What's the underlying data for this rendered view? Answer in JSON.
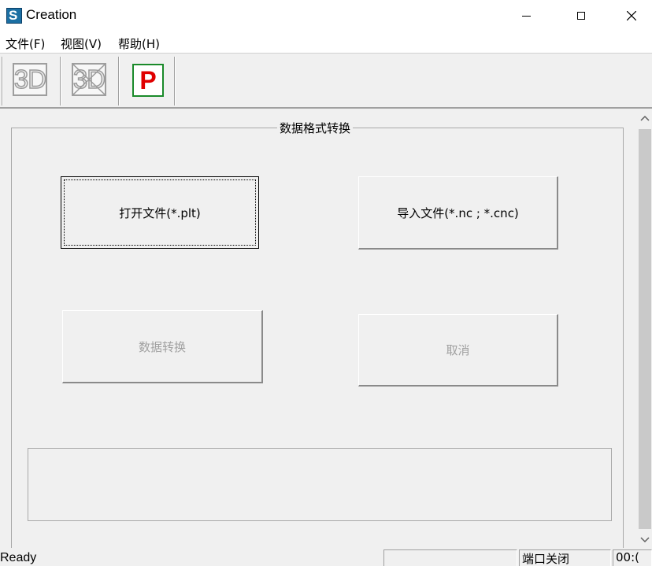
{
  "window": {
    "title": "Creation",
    "app_icon_glyph": "S",
    "controls": {
      "minimize": "minimize-icon",
      "maximize": "maximize-icon",
      "close": "close-icon"
    }
  },
  "menu": {
    "items": [
      {
        "label": "文件(F)"
      },
      {
        "label": "视图(V)"
      },
      {
        "label": "帮助(H)"
      }
    ]
  },
  "toolbar": {
    "buttons": [
      {
        "label": "3D",
        "icon": "3d-view-icon",
        "state": "disabled"
      },
      {
        "label": "3D",
        "icon": "3d-crossed-icon",
        "state": "disabled"
      },
      {
        "label": "P",
        "icon": "p-icon",
        "state": "enabled"
      }
    ]
  },
  "group": {
    "title": "数据格式转换",
    "open_file_label": "打开文件(*.plt)",
    "import_file_label": "导入文件(*.nc ; *.cnc)",
    "convert_label": "数据转换",
    "cancel_label": "取消",
    "output_text": ""
  },
  "status": {
    "ready": "Ready",
    "pane1": "",
    "port": "端口关闭",
    "time": "00:("
  },
  "colors": {
    "background": "#f0f0f0",
    "p_icon_text": "#e00000",
    "p_icon_border": "#1a8a2a",
    "app_icon": "#1b6fa3"
  }
}
